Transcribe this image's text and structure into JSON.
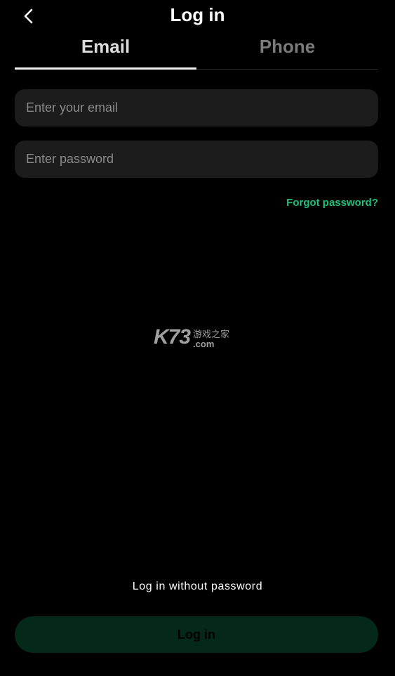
{
  "header": {
    "title": "Log in",
    "back_icon": "chevron-left-icon"
  },
  "tabs": [
    {
      "label": "Email",
      "active": true
    },
    {
      "label": "Phone",
      "active": false
    }
  ],
  "form": {
    "email_placeholder": "Enter your email",
    "email_value": "",
    "password_placeholder": "Enter password",
    "password_value": "",
    "forgot_label": "Forgot password?"
  },
  "watermark": {
    "brand": "K73",
    "tagline": "游戏之家",
    "domain": ".com"
  },
  "footer": {
    "passwordless_label": "Log in without password",
    "login_label": "Log in"
  },
  "colors": {
    "background": "#000000",
    "accent": "#22c07a",
    "field_bg": "#1c1c1c",
    "login_button_bg": "#04281a"
  }
}
